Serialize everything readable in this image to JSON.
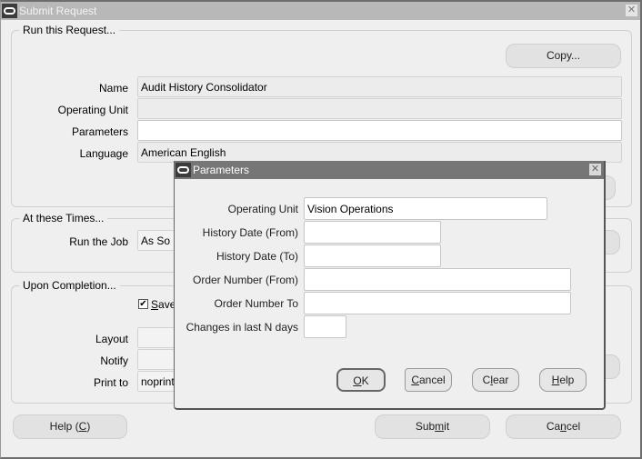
{
  "window": {
    "title": "Submit Request",
    "icon": "oracle-ring-icon",
    "close_icon": "close-icon",
    "close_glyph": "✕"
  },
  "run_request": {
    "group_label": "Run this Request...",
    "copy_button": "Copy...",
    "fields": {
      "name": {
        "label": "Name",
        "value": "Audit History Consolidator"
      },
      "operating_unit": {
        "label": "Operating Unit",
        "value": ""
      },
      "parameters": {
        "label": "Parameters",
        "value": ""
      },
      "language": {
        "label": "Language",
        "value": "American English"
      }
    }
  },
  "times": {
    "group_label": "At these Times...",
    "run_job": {
      "label": "Run the Job",
      "value": "As So"
    }
  },
  "completion": {
    "group_label": "Upon Completion...",
    "save_checkbox": {
      "label_prefix": "",
      "mnemonic": "S",
      "label_rest": "ave",
      "checked": true,
      "check_glyph": "✔"
    },
    "layout": {
      "label": "Layout",
      "value": ""
    },
    "notify": {
      "label": "Notify",
      "value": ""
    },
    "print_to": {
      "label": "Print to",
      "value": "noprint"
    }
  },
  "footer": {
    "help": {
      "prefix": "Help (",
      "mnemonic": "C",
      "suffix": ")"
    },
    "submit": {
      "prefix": "Sub",
      "mnemonic": "m",
      "suffix": "it"
    },
    "cancel": {
      "prefix": "Ca",
      "mnemonic": "n",
      "suffix": "cel"
    }
  },
  "dialog": {
    "title": "Parameters",
    "close_glyph": "✕",
    "fields": [
      {
        "label": "Operating Unit",
        "value": "Vision Operations"
      },
      {
        "label": "History Date (From)",
        "value": ""
      },
      {
        "label": "History Date (To)",
        "value": ""
      },
      {
        "label": "Order Number (From)",
        "value": ""
      },
      {
        "label": "Order Number To",
        "value": ""
      },
      {
        "label": "Changes in last N days",
        "value": ""
      }
    ],
    "buttons": {
      "ok": {
        "prefix": "",
        "mnemonic": "O",
        "suffix": "K"
      },
      "cancel": {
        "prefix": "",
        "mnemonic": "C",
        "suffix": "ancel"
      },
      "clear": {
        "prefix": "C",
        "mnemonic": "l",
        "suffix": "ear"
      },
      "help": {
        "prefix": "",
        "mnemonic": "H",
        "suffix": "elp"
      }
    }
  }
}
